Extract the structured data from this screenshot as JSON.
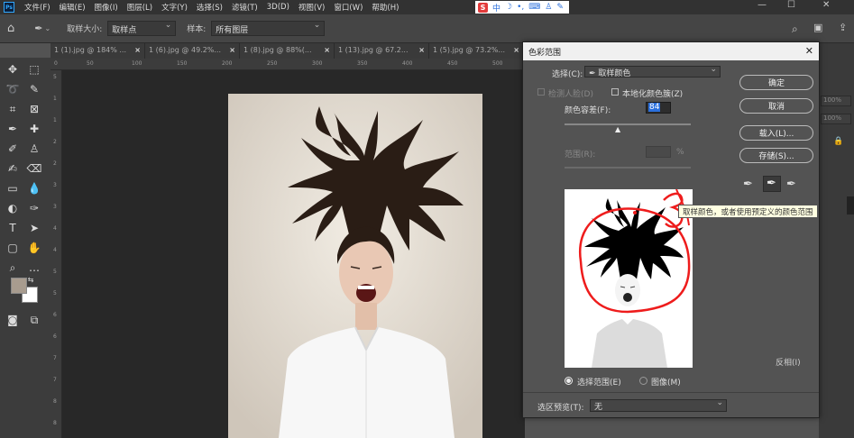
{
  "menubar": {
    "logo": "Ps",
    "items": [
      "文件(F)",
      "编辑(E)",
      "图像(I)",
      "图层(L)",
      "文字(Y)",
      "选择(S)",
      "滤镜(T)",
      "3D(D)",
      "视图(V)",
      "窗口(W)",
      "帮助(H)"
    ],
    "ime_label": "中",
    "ime_logo": "S"
  },
  "options": {
    "sample_size_label": "取样大小:",
    "sample_size_value": "取样点",
    "sample_label": "样本:",
    "sample_value": "所有图层"
  },
  "tabs": [
    {
      "label": "1 (1).jpg @ 184% ..."
    },
    {
      "label": "1 (6).jpg @ 49.2%..."
    },
    {
      "label": "1 (8).jpg @ 88%(..."
    },
    {
      "label": "1 (13).jpg @ 67.2..."
    },
    {
      "label": "1 (5).jpg @ 73.2%..."
    }
  ],
  "ruler_top": [
    "0",
    "50",
    "100",
    "150",
    "200",
    "250",
    "300",
    "350",
    "400",
    "450",
    "500"
  ],
  "ruler_left": [
    "5",
    "1",
    "1",
    "2",
    "2",
    "3",
    "3",
    "4",
    "4",
    "5",
    "5",
    "6",
    "6",
    "7",
    "7",
    "8",
    "8"
  ],
  "dialog": {
    "title": "色彩范围",
    "select_label": "选择(C):",
    "select_value": "取样颜色",
    "detect_faces": "检测人脸(D)",
    "localized_clusters": "本地化颜色簇(Z)",
    "fuzziness_label": "颜色容差(F):",
    "fuzziness_value": "84",
    "range_label": "范围(R):",
    "range_unit": "%",
    "ok": "确定",
    "cancel": "取消",
    "load": "载入(L)...",
    "save": "存储(S)...",
    "invert": "反相(I)",
    "radio_selection": "选择范围(E)",
    "radio_image": "图像(M)",
    "preview_label": "选区预览(T):",
    "preview_value": "无",
    "tooltip": "取样颜色，或者使用预定义的颜色范围"
  },
  "right_panel": {
    "zoom_value1": "100%",
    "zoom_value2": "100%"
  },
  "colors": {
    "foreground": "#a89c8f",
    "background": "#ffffff",
    "annotation": "#ee1c1c"
  }
}
